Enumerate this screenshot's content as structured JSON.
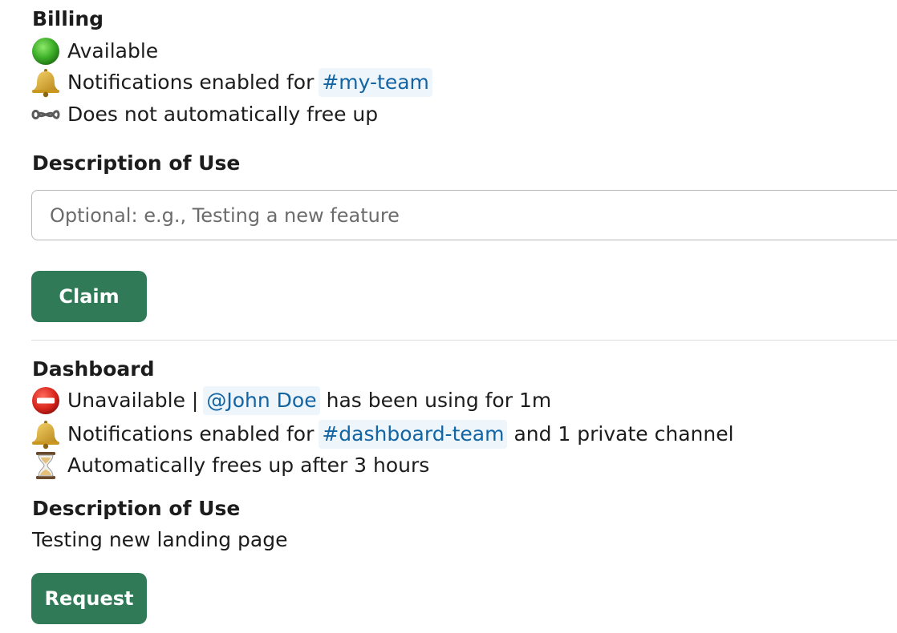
{
  "billing": {
    "title": "Billing",
    "status": "Available",
    "notifications_prefix": "Notifications enabled for",
    "notifications_channel": "#my-team",
    "free_up": "Does not automatically free up",
    "description_heading": "Description of Use",
    "description_placeholder": "Optional: e.g., Testing a new feature",
    "claim_label": "Claim",
    "icons": {
      "status": "green-circle-icon",
      "notifications": "bell-icon",
      "free_up": "infinity-icon"
    }
  },
  "dashboard": {
    "title": "Dashboard",
    "status": "Unavailable |",
    "user": "@John Doe",
    "usage": "has been using for 1m",
    "notifications_prefix": "Notifications enabled for",
    "notifications_channel": "#dashboard-team",
    "notifications_suffix": "and 1 private channel",
    "free_up": "Automatically frees up after 3 hours",
    "description_heading": "Description of Use",
    "description_value": "Testing new landing page",
    "request_label": "Request",
    "icons": {
      "status": "no-entry-icon",
      "notifications": "bell-icon",
      "free_up": "hourglass-icon"
    }
  },
  "colors": {
    "button": "#307a58",
    "mention_bg": "#eef5fb",
    "mention_text": "#1264a3",
    "text": "#1d1c1d"
  }
}
